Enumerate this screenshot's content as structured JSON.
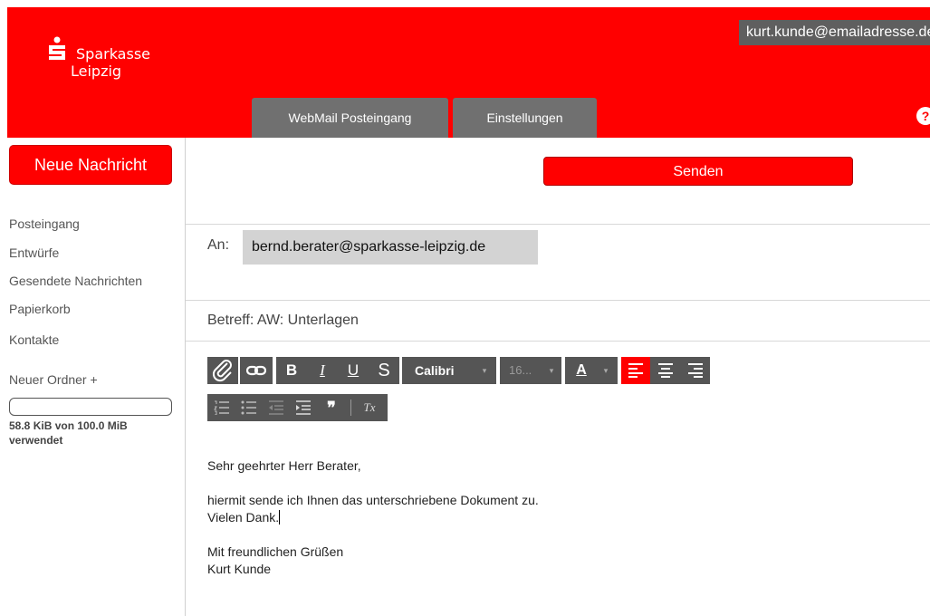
{
  "header": {
    "brand_line1": "Sparkasse",
    "brand_line2": "Leipzig",
    "user_email": "kurt.kunde@emailadresse.de",
    "tabs": [
      {
        "label": "WebMail Posteingang"
      },
      {
        "label": "Einstellungen"
      }
    ],
    "help_label": "?"
  },
  "sidebar": {
    "new_message_label": "Neue Nachricht",
    "items": [
      {
        "label": "Posteingang"
      },
      {
        "label": "Entwürfe"
      },
      {
        "label": "Gesendete Nachrichten"
      },
      {
        "label": "Papierkorb"
      },
      {
        "label": "Kontakte"
      }
    ],
    "new_folder_label": "Neuer Ordner +",
    "quota_used_fraction": 0.00057,
    "quota_text": "58.8 KiB von 100.0 MiB verwendet"
  },
  "compose": {
    "send_label": "Senden",
    "to_label": "An:",
    "to_value": "bernd.berater@sparkasse-leipzig.de",
    "subject_label": "Betreff:",
    "subject_value": "AW: Unterlagen",
    "toolbar": {
      "bold": "B",
      "italic": "I",
      "underline": "U",
      "strike": "S",
      "font": "Calibri",
      "font_size": "16...",
      "text_color": "A",
      "quote": "❞",
      "clear_format": "Tx"
    },
    "body": {
      "greeting": "Sehr geehrter Herr Berater,",
      "line1": "hiermit sende ich Ihnen das unterschriebene Dokument zu.",
      "line2": "Vielen Dank.",
      "closing": "Mit freundlichen Grüßen",
      "signature": "Kurt Kunde"
    }
  },
  "colors": {
    "brand_red": "#ff0000",
    "toolbar_gray": "#555555",
    "tab_gray": "#707070"
  }
}
